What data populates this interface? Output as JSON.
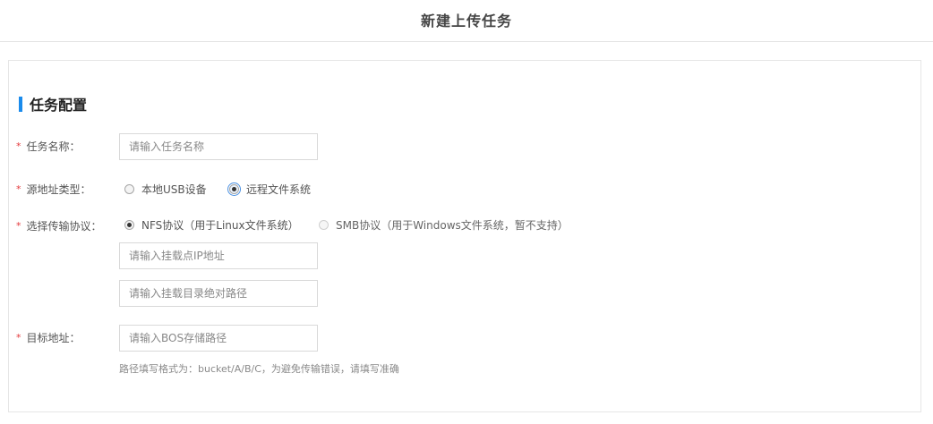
{
  "header": {
    "title": "新建上传任务"
  },
  "section": {
    "title": "任务配置"
  },
  "form": {
    "task_name": {
      "label": "任务名称：",
      "placeholder": "请输入任务名称",
      "value": ""
    },
    "source_type": {
      "label": "源地址类型：",
      "options": [
        {
          "label": "本地USB设备",
          "checked": false
        },
        {
          "label": "远程文件系统",
          "checked": true
        }
      ]
    },
    "protocol": {
      "label": "选择传输协议：",
      "options": [
        {
          "label": "NFS协议（用于Linux文件系统）",
          "checked": true,
          "disabled": false
        },
        {
          "label": "SMB协议（用于Windows文件系统，暂不支持）",
          "checked": false,
          "disabled": true
        }
      ],
      "mount_ip_placeholder": "请输入挂载点IP地址",
      "mount_path_placeholder": "请输入挂载目录绝对路径"
    },
    "target": {
      "label": "目标地址：",
      "placeholder": "请输入BOS存储路径",
      "hint": "路径填写格式为：bucket/A/B/C，为避免传输错误，请填写准确"
    },
    "required_mark": "*"
  }
}
